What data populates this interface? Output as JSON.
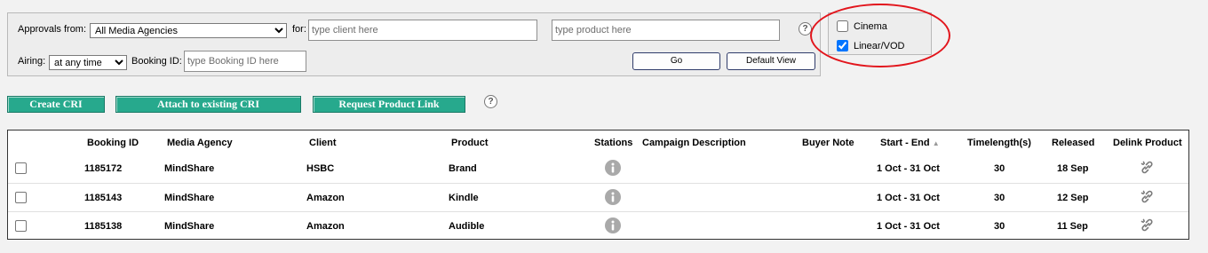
{
  "filters": {
    "approvals_from_label": "Approvals from:",
    "approvals_from_value": "All Media Agencies",
    "for_label": "for:",
    "client_placeholder": "type client here",
    "product_placeholder": "type product here",
    "airing_label": "Airing:",
    "airing_value": "at any time",
    "booking_id_label": "Booking ID:",
    "booking_id_placeholder": "type Booking ID here",
    "go_label": "Go",
    "default_view_label": "Default View",
    "help_symbol": "?"
  },
  "media_types": {
    "cinema_label": "Cinema",
    "cinema_checked": false,
    "linear_label": "Linear/VOD",
    "linear_checked": true
  },
  "actions": {
    "create_cri": "Create CRI",
    "attach_cri": "Attach to existing CRI",
    "request_link": "Request Product Link",
    "help_symbol": "?"
  },
  "table": {
    "headers": {
      "booking_id": "Booking ID",
      "media_agency": "Media Agency",
      "client": "Client",
      "product": "Product",
      "stations": "Stations",
      "campaign_description": "Campaign Description",
      "buyer_note": "Buyer Note",
      "start_end": "Start - End",
      "sort_indicator": "▲",
      "timelength": "Timelength(s)",
      "released": "Released",
      "delink_product": "Delink Product"
    },
    "rows": [
      {
        "booking_id": "1185172",
        "media_agency": "MindShare",
        "client": "HSBC",
        "product": "Brand",
        "campaign_description": "",
        "buyer_note": "",
        "start_end": "1 Oct - 31 Oct",
        "timelength": "30",
        "released": "18 Sep"
      },
      {
        "booking_id": "1185143",
        "media_agency": "MindShare",
        "client": "Amazon",
        "product": "Kindle",
        "campaign_description": "",
        "buyer_note": "",
        "start_end": "1 Oct - 31 Oct",
        "timelength": "30",
        "released": "12 Sep"
      },
      {
        "booking_id": "1185138",
        "media_agency": "MindShare",
        "client": "Amazon",
        "product": "Audible",
        "campaign_description": "",
        "buyer_note": "",
        "start_end": "1 Oct - 31 Oct",
        "timelength": "30",
        "released": "11 Sep"
      }
    ]
  },
  "icons": {
    "info": "info-icon",
    "delink": "link-icon",
    "help": "help-icon"
  },
  "colors": {
    "action_button": "#27a98d",
    "highlight_ring": "#e2151c",
    "info_icon": "#a9a9a9"
  }
}
